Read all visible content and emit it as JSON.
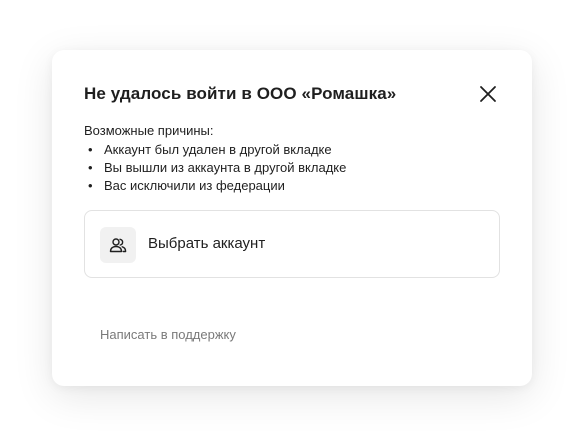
{
  "dialog": {
    "title": "Не удалось войти в ООО «Ромашка»",
    "close_icon": "close-icon",
    "reasons_heading": "Возможные причины:",
    "reasons": [
      "Аккаунт был удален в другой вкладке",
      "Вы вышли из аккаунта в другой вкладке",
      "Вас исключили из федерации"
    ],
    "bullet": "•",
    "choose_account": {
      "icon": "users-icon",
      "label": "Выбрать аккаунт"
    },
    "support_link": "Написать в поддержку"
  },
  "colors": {
    "text": "#1f1f1f",
    "muted": "#7a7a7a",
    "border": "#e2e2e2",
    "icon_bg": "#f1f1f1"
  }
}
